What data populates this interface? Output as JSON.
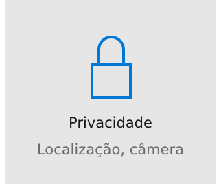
{
  "tile": {
    "title": "Privacidade",
    "subtitle": "Localização, câmera",
    "icon": "lock-icon"
  },
  "colors": {
    "accent": "#0078d7",
    "tile_background": "#e6e6e6",
    "title_text": "#1a1a1a",
    "subtitle_text": "#6b6b6b"
  }
}
